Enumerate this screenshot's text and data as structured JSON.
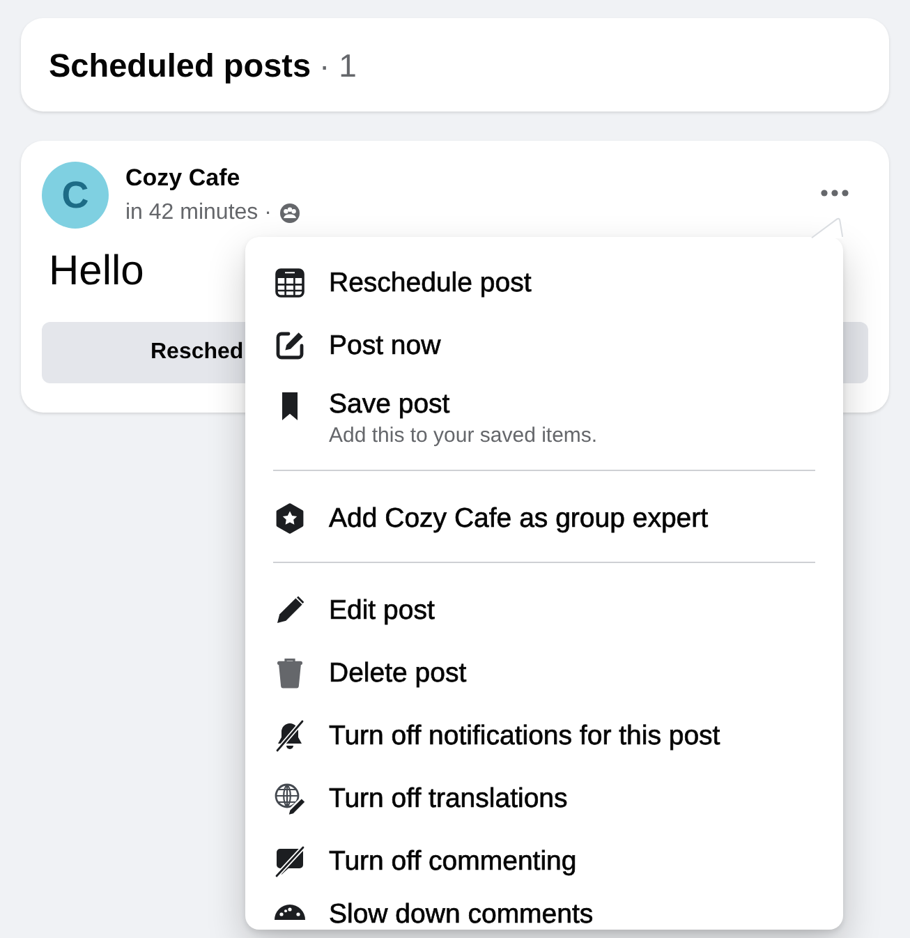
{
  "header": {
    "title": "Scheduled posts",
    "count": "· 1"
  },
  "post": {
    "avatar_initial": "C",
    "author": "Cozy Cafe",
    "time": "in 42 minutes ·",
    "text": "Hello",
    "button": "Resched"
  },
  "menu": {
    "sections": [
      [
        {
          "label": "Reschedule post"
        },
        {
          "label": "Post now"
        },
        {
          "label": "Save post",
          "description": "Add this to your saved items."
        }
      ],
      [
        {
          "label": "Add Cozy Cafe as group expert"
        }
      ],
      [
        {
          "label": "Edit post"
        },
        {
          "label": "Delete post"
        },
        {
          "label": "Turn off notifications for this post"
        },
        {
          "label": "Turn off translations"
        },
        {
          "label": "Turn off commenting"
        },
        {
          "label": "Slow down comments"
        }
      ]
    ]
  }
}
